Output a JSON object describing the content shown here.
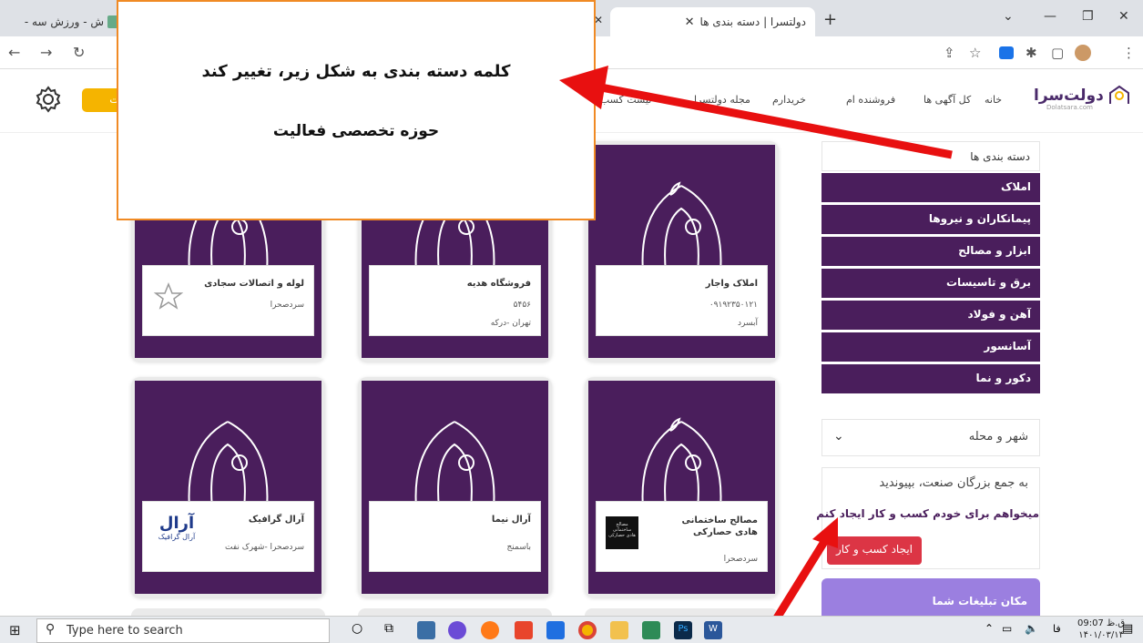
{
  "browser": {
    "tab_active_title": "دولتسرا | دسته بندی ها",
    "tab_left_title": "ش - ورزش سه -",
    "new_tab": "+",
    "close": "✕"
  },
  "site": {
    "logo_text": "دولت‌سرا",
    "logo_sub": "Dolatsara.com",
    "nav": {
      "home": "خانه",
      "all_ads": "کل آگهی ها",
      "my_sales": "فروشنده ام",
      "my_buys": "خریدارم",
      "magazine": "مجله دولتسرا",
      "business_list": "لیست کسب و کار ها"
    },
    "ad_button": "ثبت آگهی"
  },
  "sidebar": {
    "categories_title": "دسته بندی ها",
    "categories": [
      "املاک",
      "پیمانکاران و نیروها",
      "ابزار و مصالح",
      "برق و تاسیسات",
      "آهن و فولاد",
      "آسانسور",
      "دکور و نما"
    ],
    "city_label": "شهر و محله",
    "join_title": "به جمع بزرگان صنعت، بپیوندید",
    "join_text": "میخواهم برای خودم کسب و کار ایجاد کنم",
    "create_business_button": "ایجاد کسب و کار",
    "ad_space": "مکان تبلیغات شما"
  },
  "cards": [
    {
      "name": "املاک واجار",
      "line2": "۰۹۱۹۲۳۵۰۱۲۱",
      "line3": "آبسرد"
    },
    {
      "name": "فروشگاه هدیه",
      "line2": "۵۴۵۶",
      "line3": "تهران -درکه"
    },
    {
      "name": "لوله و اتصالات سجادی",
      "line2": "سردصحرا",
      "line3": ""
    },
    {
      "name": "مصالح ساختمانی هادی حصارکی",
      "line2": "",
      "line3": "سردصحرا"
    },
    {
      "name": "آرال نیما",
      "line2": "باسمنج",
      "line3": ""
    },
    {
      "name": "آرال گرافیک",
      "line2": "سردصحرا -شهرک نفت",
      "line3": ""
    }
  ],
  "card_logo_texts": {
    "aral": "آرال",
    "aral_sub": "آرال گرافیک",
    "hadi": "مصالح ساختمانی هادی حصارکی"
  },
  "annotation": {
    "line1": "کلمه دسته بندی به شکل زیر، تغییر کند",
    "line2": "حوزه تخصصی فعالیت"
  },
  "taskbar": {
    "search_placeholder": "Type here to search",
    "lang": "فا",
    "time": "09:07 ق.ظ",
    "date": "۱۴۰۱/۰۳/۱۴"
  },
  "colors": {
    "brand_purple": "#4a1e5c",
    "accent_orange": "#f08a24",
    "arrow_red": "#e81010",
    "button_red": "#dc3545",
    "ad_yellow": "#f5b400"
  }
}
